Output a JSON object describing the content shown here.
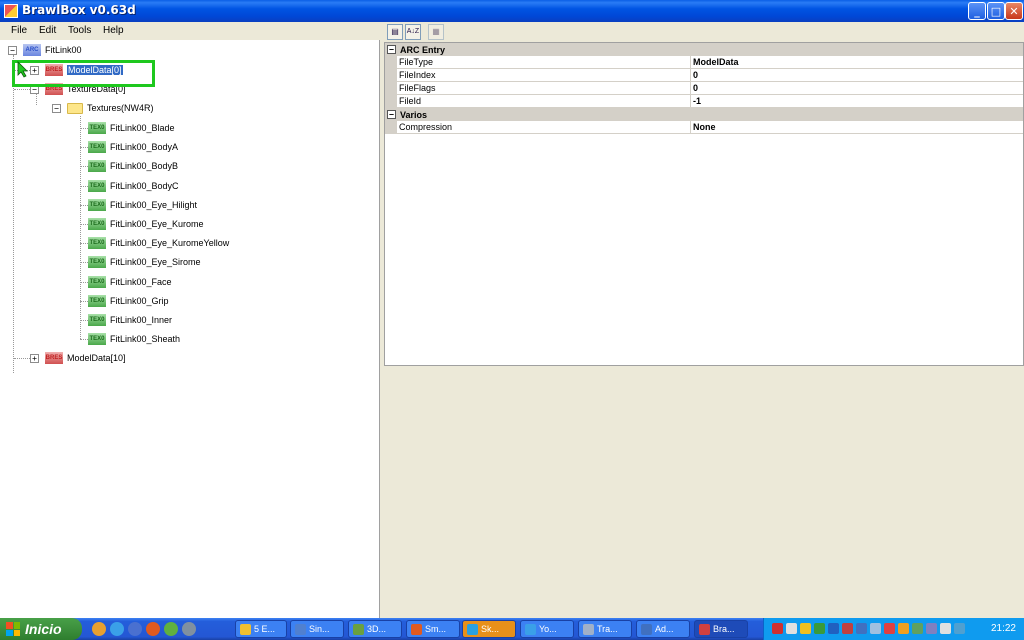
{
  "window": {
    "title": "BrawlBox v0.63d",
    "minimize_glyph": "_",
    "maximize_glyph": "□",
    "close_glyph": "✕"
  },
  "menu": [
    "File",
    "Edit",
    "Tools",
    "Help"
  ],
  "tree": {
    "root": {
      "tag": "ARC",
      "label": "FitLink00",
      "expander": "−"
    },
    "model_data_0": {
      "tag": "BRES",
      "label": "ModelData[0]",
      "expander": "+"
    },
    "texture_data_0": {
      "tag": "BRES",
      "label": "TextureData[0]",
      "expander": "−"
    },
    "textures_folder": {
      "label": "Textures(NW4R)",
      "expander": "−"
    },
    "textures": [
      {
        "tag": "TEX0",
        "label": "FitLink00_Blade"
      },
      {
        "tag": "TEX0",
        "label": "FitLink00_BodyA"
      },
      {
        "tag": "TEX0",
        "label": "FitLink00_BodyB"
      },
      {
        "tag": "TEX0",
        "label": "FitLink00_BodyC"
      },
      {
        "tag": "TEX0",
        "label": "FitLink00_Eye_Hilight"
      },
      {
        "tag": "TEX0",
        "label": "FitLink00_Eye_Kurome"
      },
      {
        "tag": "TEX0",
        "label": "FitLink00_Eye_KuromeYellow"
      },
      {
        "tag": "TEX0",
        "label": "FitLink00_Eye_Sirome"
      },
      {
        "tag": "TEX0",
        "label": "FitLink00_Face"
      },
      {
        "tag": "TEX0",
        "label": "FitLink00_Grip"
      },
      {
        "tag": "TEX0",
        "label": "FitLink00_Inner"
      },
      {
        "tag": "TEX0",
        "label": "FitLink00_Sheath"
      }
    ],
    "model_data_10": {
      "tag": "BRES",
      "label": "ModelData[10]",
      "expander": "+"
    }
  },
  "property_toolbar": {
    "categorized_glyph": "▤",
    "alphabetical_glyph": "A↓Z",
    "pages_glyph": "▦"
  },
  "properties": {
    "categories": [
      {
        "name": "ARC Entry",
        "expander": "−",
        "rows": [
          {
            "name": "FileType",
            "value": "ModelData"
          },
          {
            "name": "FileIndex",
            "value": "0"
          },
          {
            "name": "FileFlags",
            "value": "0"
          },
          {
            "name": "FileId",
            "value": "-1"
          }
        ]
      },
      {
        "name": "Varios",
        "expander": "−",
        "rows": [
          {
            "name": "Compression",
            "value": "None"
          }
        ]
      }
    ]
  },
  "taskbar": {
    "start_label": "Inicio",
    "tasks": [
      {
        "label": "5 E..."
      },
      {
        "label": "Sin..."
      },
      {
        "label": "3D..."
      },
      {
        "label": "Sm..."
      },
      {
        "label": "Sk..."
      },
      {
        "label": "Yo..."
      },
      {
        "label": "Tra..."
      },
      {
        "label": "Ad..."
      },
      {
        "label": "Bra..."
      }
    ],
    "clock": "21:22"
  },
  "colors": {
    "selection": "#316ac5",
    "highlight_box": "#1ec81e",
    "taskbar": "#245edb",
    "start_button": "#3c8f3c"
  }
}
